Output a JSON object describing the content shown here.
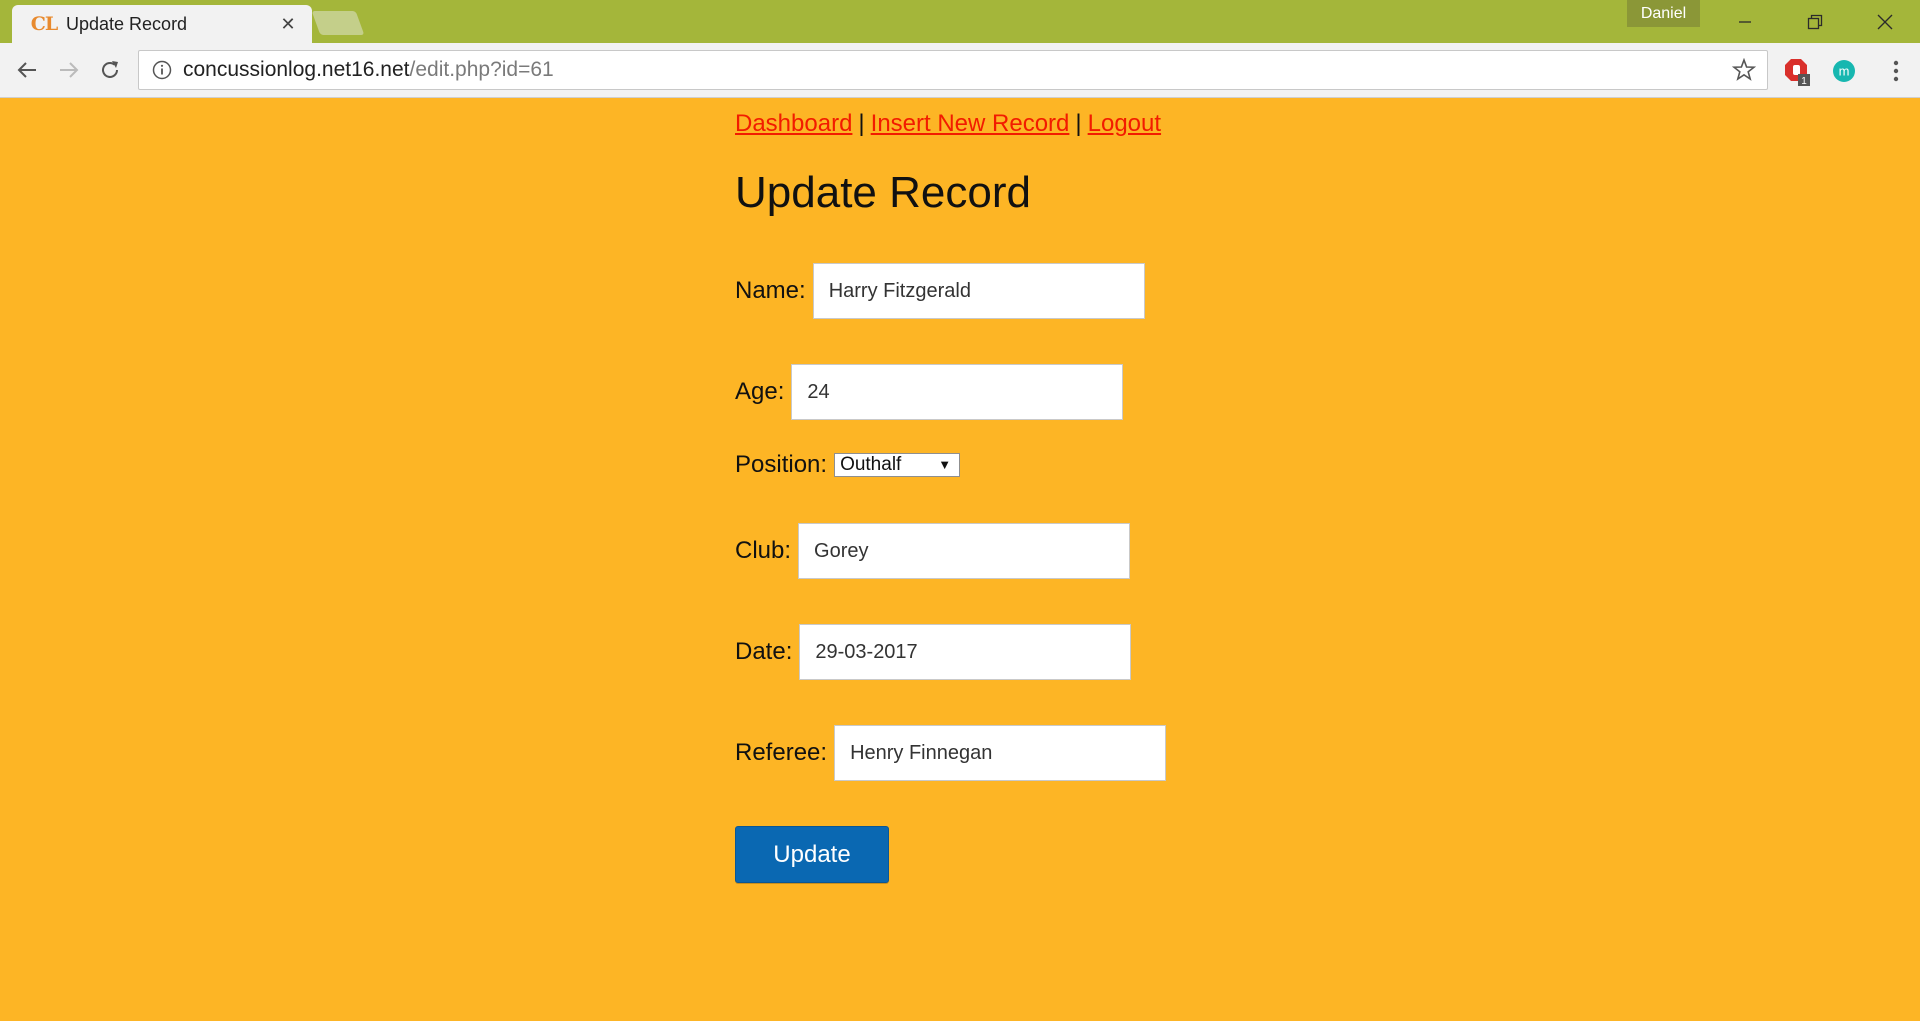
{
  "browser": {
    "tab_title": "Update Record",
    "favicon_text": "CL",
    "profile_name": "Daniel",
    "url_host": "concussionlog.net16.net",
    "url_path": "/edit.php?id=61",
    "extension_badge": "1",
    "extension_m": "m"
  },
  "nav": {
    "dashboard": "Dashboard",
    "insert": "Insert New Record",
    "logout": "Logout",
    "separator": "|"
  },
  "page": {
    "title": "Update Record"
  },
  "form": {
    "name_label": "Name:",
    "name_value": "Harry Fitzgerald",
    "age_label": "Age:",
    "age_value": "24",
    "position_label": "Position:",
    "position_value": "Outhalf",
    "club_label": "Club:",
    "club_value": "Gorey",
    "date_label": "Date:",
    "date_value": "29-03-2017",
    "referee_label": "Referee:",
    "referee_value": "Henry Finnegan",
    "submit_label": "Update"
  },
  "colors": {
    "page_background": "#fdb525",
    "link": "#f21b00",
    "button": "#0a68b2",
    "titlebar": "#a4b63a"
  }
}
